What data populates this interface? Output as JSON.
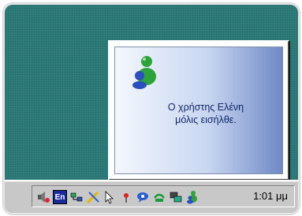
{
  "notification": {
    "line1": "Ο χρήστης Ελένη",
    "line2": "μόλις εισήλθε."
  },
  "tray": {
    "language_label": "En",
    "time": "1:01 μμ",
    "icons": [
      "volume-icon",
      "language-indicator",
      "network-icon",
      "pen-tool-icon",
      "mouse-pointer-icon",
      "signal-icon",
      "messenger-chat-icon",
      "connection-icon",
      "display-icon",
      "msn-messenger-icon"
    ]
  },
  "colors": {
    "desktop": "#2f7f7d",
    "taskbar": "#c8c8c8",
    "message_text": "#10266a",
    "msn_green": "#2ea33a",
    "msn_blue": "#2b4fc0"
  }
}
